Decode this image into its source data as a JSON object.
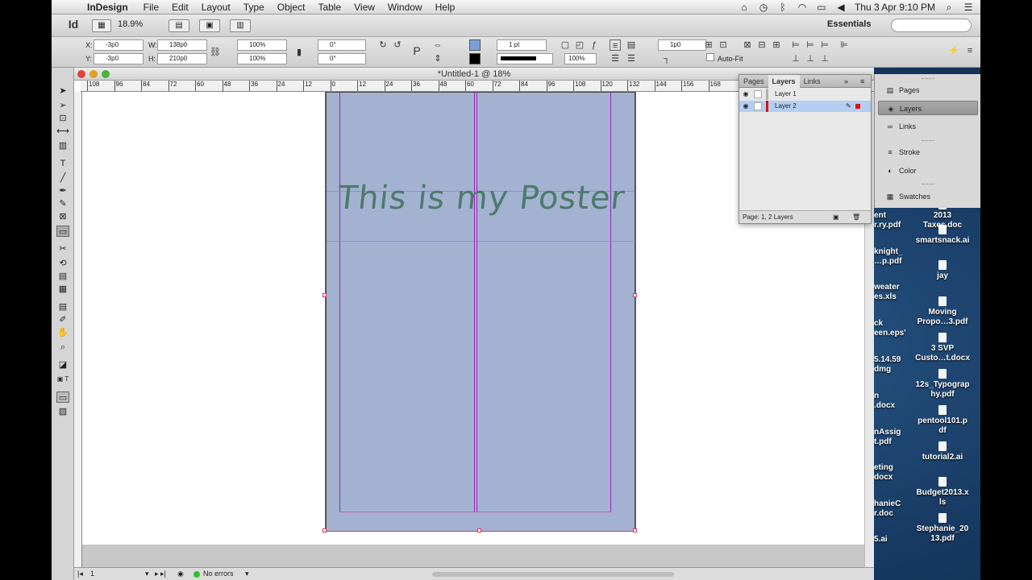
{
  "menubar": {
    "app_name": "InDesign",
    "menus": [
      "File",
      "Edit",
      "Layout",
      "Type",
      "Object",
      "Table",
      "View",
      "Window",
      "Help"
    ],
    "clock": "Thu 3 Apr  9:10 PM"
  },
  "appbar": {
    "logo": "Id",
    "zoom": "18.9%",
    "workspace": "Essentials"
  },
  "control": {
    "x_label": "X:",
    "x_value": "-3p0",
    "y_label": "Y:",
    "y_value": "-3p0",
    "w_label": "W:",
    "w_value": "138p0",
    "h_label": "H:",
    "h_value": "210p0",
    "scale_x": "100%",
    "scale_y": "100%",
    "rotate": "0°",
    "shear": "0°",
    "stroke_weight": "1 pt",
    "opacity": "100%",
    "offset": "1p0",
    "autofit": "Auto-Fit"
  },
  "document": {
    "title": "*Untitled-1 @ 18%",
    "poster_text": "This is my Poster",
    "ruler_labels": [
      "108",
      "96",
      "84",
      "72",
      "60",
      "48",
      "36",
      "24",
      "12",
      "0",
      "12",
      "24",
      "36",
      "48",
      "60",
      "72",
      "84",
      "96",
      "108",
      "120",
      "132",
      "144",
      "156",
      "168"
    ],
    "status_page": "1",
    "status_errors": "No errors"
  },
  "layers_panel": {
    "tabs": [
      "Pages",
      "Layers",
      "Links"
    ],
    "active_tab": "Layers",
    "layers": [
      {
        "name": "Layer 1",
        "color": "#b0b0b0"
      },
      {
        "name": "Layer 2",
        "color": "#e01010"
      }
    ],
    "footer": "Page: 1, 2 Layers"
  },
  "dock": {
    "items": [
      {
        "label": "Pages",
        "icon": "pages-icon"
      },
      {
        "label": "Layers",
        "icon": "layers-icon"
      },
      {
        "label": "Links",
        "icon": "links-icon"
      },
      {
        "label": "Stroke",
        "icon": "stroke-icon"
      },
      {
        "label": "Color",
        "icon": "color-icon"
      },
      {
        "label": "Swatches",
        "icon": "swatches-icon"
      }
    ]
  },
  "desktop": {
    "files": [
      {
        "line1": "2013",
        "line2": "Taxes.doc"
      },
      {
        "line1": "smartsnack.ai",
        "line2": ""
      },
      {
        "line1": "jay",
        "line2": ""
      },
      {
        "line1": "Moving",
        "line2": "Propo…3.pdf"
      },
      {
        "line1": "3 SVP",
        "line2": "Custo…t.docx"
      },
      {
        "line1": "12s_Typograp",
        "line2": "hy.pdf"
      },
      {
        "line1": "pentool101.p",
        "line2": "df"
      },
      {
        "line1": "tutorial2.ai",
        "line2": ""
      },
      {
        "line1": "Budget2013.x",
        "line2": "ls"
      },
      {
        "line1": "Stephanie_20",
        "line2": "13.pdf"
      }
    ],
    "partial": [
      "ent",
      "r.ry.pdf",
      "knight_",
      "…p.pdf",
      "weater",
      "es.xls",
      "ck",
      "een.eps'",
      "5.14.59",
      "dmg",
      "n",
      ".docx",
      "nAssig",
      "t.pdf",
      "eting",
      "docx",
      "hanieC",
      "r.doc",
      "5.ai"
    ]
  },
  "colors": {
    "page_fill": "#a4b2d2",
    "title_color": "#4c7b6a",
    "guide": "#a020c0",
    "selection": "#e0305a"
  }
}
